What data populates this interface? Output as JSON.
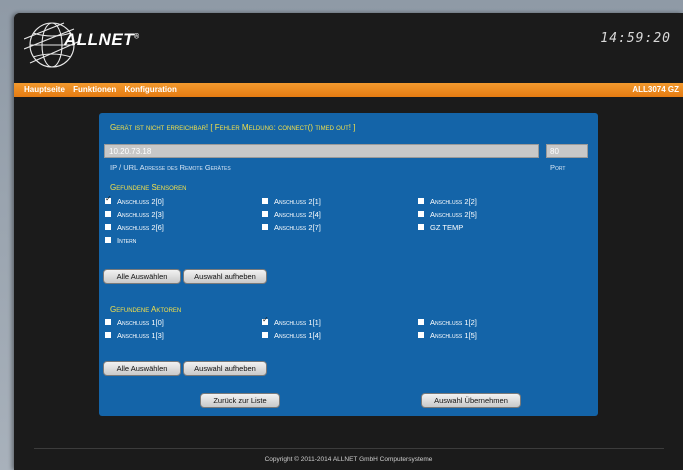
{
  "header": {
    "brand": "ALLNET",
    "trademark": "®",
    "clock": "14:59:20"
  },
  "menu": {
    "items": [
      "Hauptseite",
      "Funktionen",
      "Konfiguration"
    ],
    "device": "ALL3074 GZ"
  },
  "panel": {
    "error_message": "Gerät ist nicht erreichbar! [ Fehler Meldung: connect() timed out! ]",
    "ip_value": "10.20.73.18",
    "port_value": "80",
    "ip_label": "IP / URL Adresse des Remote Gerätes",
    "port_label": "Port",
    "sensors_title": "Gefundene Sensoren",
    "sensors": [
      {
        "label": "Anschluß 2[0]",
        "checked": true
      },
      {
        "label": "Anschluß 2[1]",
        "checked": false
      },
      {
        "label": "Anschluß 2[2]",
        "checked": false
      },
      {
        "label": "Anschluß 2[3]",
        "checked": false
      },
      {
        "label": "Anschluß 2[4]",
        "checked": false
      },
      {
        "label": "Anschluß 2[5]",
        "checked": false
      },
      {
        "label": "Anschluß 2[6]",
        "checked": false
      },
      {
        "label": "Anschluß 2[7]",
        "checked": false
      },
      {
        "label": "GZ TEMP",
        "checked": false
      },
      {
        "label": "Intern",
        "checked": false
      }
    ],
    "select_all_label": "Alle Auswählen",
    "deselect_label": "Auswahl aufheben",
    "actors_title": "Gefundene Aktoren",
    "actors": [
      {
        "label": "Anschluß 1[0]",
        "checked": false
      },
      {
        "label": "Anschluß 1[1]",
        "checked": true
      },
      {
        "label": "Anschluß 1[2]",
        "checked": false
      },
      {
        "label": "Anschluß 1[3]",
        "checked": false
      },
      {
        "label": "Anschluß 1[4]",
        "checked": false
      },
      {
        "label": "Anschluß 1[5]",
        "checked": false
      }
    ],
    "back_label": "Zurück zur Liste",
    "apply_label": "Auswahl Übernehmen"
  },
  "footer": {
    "copyright": "Copyright © 2011-2014 ALLNET GmbH Computersysteme"
  },
  "colors": {
    "accent": "#e98716",
    "panel": "#1464a8",
    "highlight": "#f3e04a"
  }
}
